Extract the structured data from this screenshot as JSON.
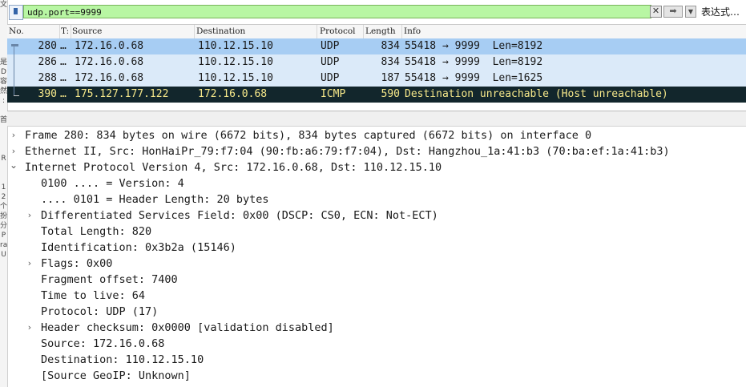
{
  "filter": {
    "value": "udp.port==9999",
    "clear_label": "✕",
    "apply_label": "➡",
    "dropdown_label": "▼",
    "expression_label": "表达式…"
  },
  "packet_list": {
    "columns": [
      "No.",
      "T:",
      "Source",
      "Destination",
      "Protocol",
      "Length",
      "Info"
    ],
    "rows": [
      {
        "no": "280",
        "time": "…",
        "source": "172.16.0.68",
        "destination": "110.12.15.10",
        "protocol": "UDP",
        "length": "834",
        "info": "55418 → 9999  Len=8192",
        "state": "selected"
      },
      {
        "no": "286",
        "time": "…",
        "source": "172.16.0.68",
        "destination": "110.12.15.10",
        "protocol": "UDP",
        "length": "834",
        "info": "55418 → 9999  Len=8192",
        "state": "normal"
      },
      {
        "no": "288",
        "time": "…",
        "source": "172.16.0.68",
        "destination": "110.12.15.10",
        "protocol": "UDP",
        "length": "187",
        "info": "55418 → 9999  Len=1625",
        "state": "normal"
      },
      {
        "no": "390",
        "time": "…",
        "source": "175.127.177.122",
        "destination": "172.16.0.68",
        "protocol": "ICMP",
        "length": "590",
        "info": "Destination unreachable (Host unreachable)",
        "state": "icmp"
      }
    ]
  },
  "details": [
    {
      "text": "Frame 280: 834 bytes on wire (6672 bits), 834 bytes captured (6672 bits) on interface 0",
      "level": 0,
      "toggle": "collapsed"
    },
    {
      "text": "Ethernet II, Src: HonHaiPr_79:f7:04 (90:fb:a6:79:f7:04), Dst: Hangzhou_1a:41:b3 (70:ba:ef:1a:41:b3)",
      "level": 0,
      "toggle": "collapsed"
    },
    {
      "text": "Internet Protocol Version 4, Src: 172.16.0.68, Dst: 110.12.15.10",
      "level": 0,
      "toggle": "expanded"
    },
    {
      "text": "0100 .... = Version: 4",
      "level": 1,
      "toggle": "none"
    },
    {
      "text": ".... 0101 = Header Length: 20 bytes",
      "level": 1,
      "toggle": "none"
    },
    {
      "text": "Differentiated Services Field: 0x00 (DSCP: CS0, ECN: Not-ECT)",
      "level": 1,
      "toggle": "collapsed"
    },
    {
      "text": "Total Length: 820",
      "level": 1,
      "toggle": "none"
    },
    {
      "text": "Identification: 0x3b2a (15146)",
      "level": 1,
      "toggle": "none"
    },
    {
      "text": "Flags: 0x00",
      "level": 1,
      "toggle": "collapsed"
    },
    {
      "text": "Fragment offset: 7400",
      "level": 1,
      "toggle": "none"
    },
    {
      "text": "Time to live: 64",
      "level": 1,
      "toggle": "none"
    },
    {
      "text": "Protocol: UDP (17)",
      "level": 1,
      "toggle": "none"
    },
    {
      "text": "Header checksum: 0x0000 [validation disabled]",
      "level": 1,
      "toggle": "collapsed"
    },
    {
      "text": "Source: 172.16.0.68",
      "level": 1,
      "toggle": "none"
    },
    {
      "text": "Destination: 110.12.15.10",
      "level": 1,
      "toggle": "none"
    },
    {
      "text": "[Source GeoIP: Unknown]",
      "level": 1,
      "toggle": "none"
    }
  ],
  "toggle_glyphs": {
    "collapsed": "›",
    "expanded": "⌄",
    "none": ""
  },
  "left_strip": [
    "文",
    "",
    "",
    "",
    "",
    "",
    "是",
    "D",
    "容",
    "然",
    ":",
    "",
    "首",
    "",
    "",
    "",
    "R",
    "",
    "",
    "1",
    "2",
    "个",
    "扮",
    "分",
    "P",
    "ra",
    "U",
    "",
    "",
    ""
  ],
  "colors": {
    "selected_row": "#a7cdf3",
    "normal_row": "#dbeaf9",
    "icmp_row_bg": "#12262c",
    "icmp_row_fg": "#f6e88a",
    "filter_valid": "#b8f6a3"
  }
}
